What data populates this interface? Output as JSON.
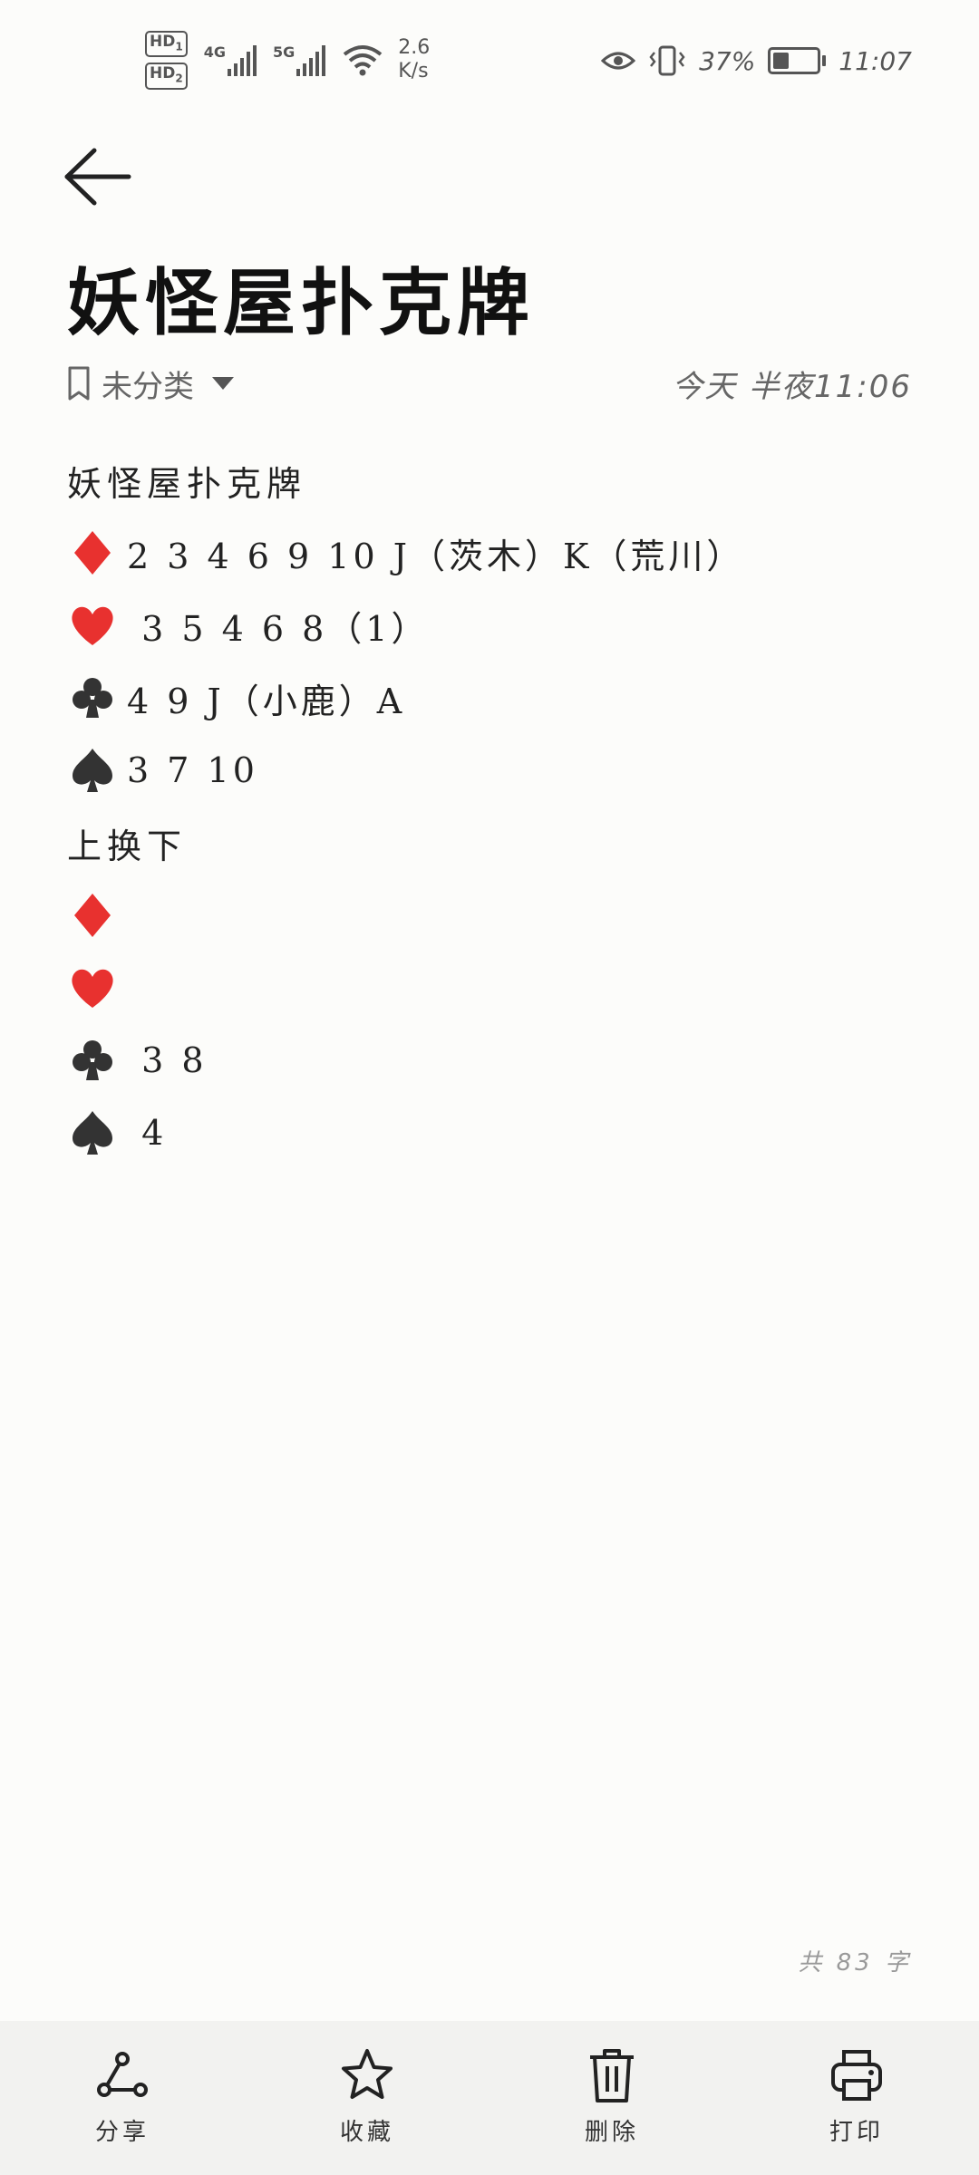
{
  "status_bar": {
    "hd1": "HD",
    "hd1_sub": "1",
    "hd2": "HD",
    "hd2_sub": "2",
    "sim1_type": "4G",
    "sim2_type": "5G",
    "net_speed_value": "2.6",
    "net_speed_unit": "K/s",
    "battery_percent": "37%",
    "battery_level": 0.37,
    "time": "11:07",
    "icon_color": "#555555"
  },
  "header": {
    "back_icon": "back-arrow-icon",
    "title": "妖怪屋扑克牌",
    "category": "未分类",
    "timestamp": "今天 半夜11:06"
  },
  "note": {
    "lines": [
      {
        "suit": "",
        "text": "妖怪屋扑克牌"
      },
      {
        "suit": "diamond",
        "text": "2 3 4 6 9 10 J（茨木）K（荒川）"
      },
      {
        "suit": "heart",
        "text": " 3 5 4 6 8（1）"
      },
      {
        "suit": "club",
        "text": "4 9 J（小鹿）A"
      },
      {
        "suit": "spade",
        "text": "3 7 10"
      },
      {
        "suit": "",
        "text": "上换下"
      },
      {
        "suit": "diamond",
        "text": ""
      },
      {
        "suit": "heart",
        "text": ""
      },
      {
        "suit": "club",
        "text": " 3 8"
      },
      {
        "suit": "spade",
        "text": " 4"
      }
    ],
    "suit_colors": {
      "diamond": "#e8312f",
      "heart": "#e8312f",
      "club": "#333333",
      "spade": "#333333"
    }
  },
  "word_count": "共 83 字",
  "toolbar": {
    "share": "分享",
    "favorite": "收藏",
    "delete": "删除",
    "print": "打印"
  }
}
